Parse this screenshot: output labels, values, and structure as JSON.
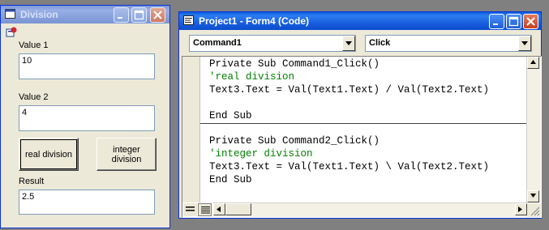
{
  "division_form": {
    "title": "Division",
    "value1_label": "Value 1",
    "value1": "10",
    "value2_label": "Value 2",
    "value2": "4",
    "real_button": "real division",
    "integer_button_line1": "integer",
    "integer_button_line2": "division",
    "result_label": "Result",
    "result": "2.5"
  },
  "code_window": {
    "title": "Project1 - Form4 (Code)",
    "object_combo": "Command1",
    "procedure_combo": "Click",
    "code_lines": [
      "Private Sub Command1_Click()",
      "'real division",
      "Text3.Text = Val(Text1.Text) / Val(Text2.Text)",
      "",
      "End Sub",
      "Private Sub Command2_Click()",
      "'integer division",
      "Text3.Text = Val(Text1.Text) \\ Val(Text2.Text)",
      "End Sub"
    ]
  },
  "colors": {
    "titlebar_active": "#0a5ddd",
    "titlebar_inactive": "#7d97d6",
    "comment": "#008000",
    "desktop": "#808080"
  },
  "icons": [
    "form-icon",
    "minimize-icon",
    "maximize-icon",
    "close-icon",
    "vb-code-icon",
    "dropdown-arrow-icon"
  ]
}
